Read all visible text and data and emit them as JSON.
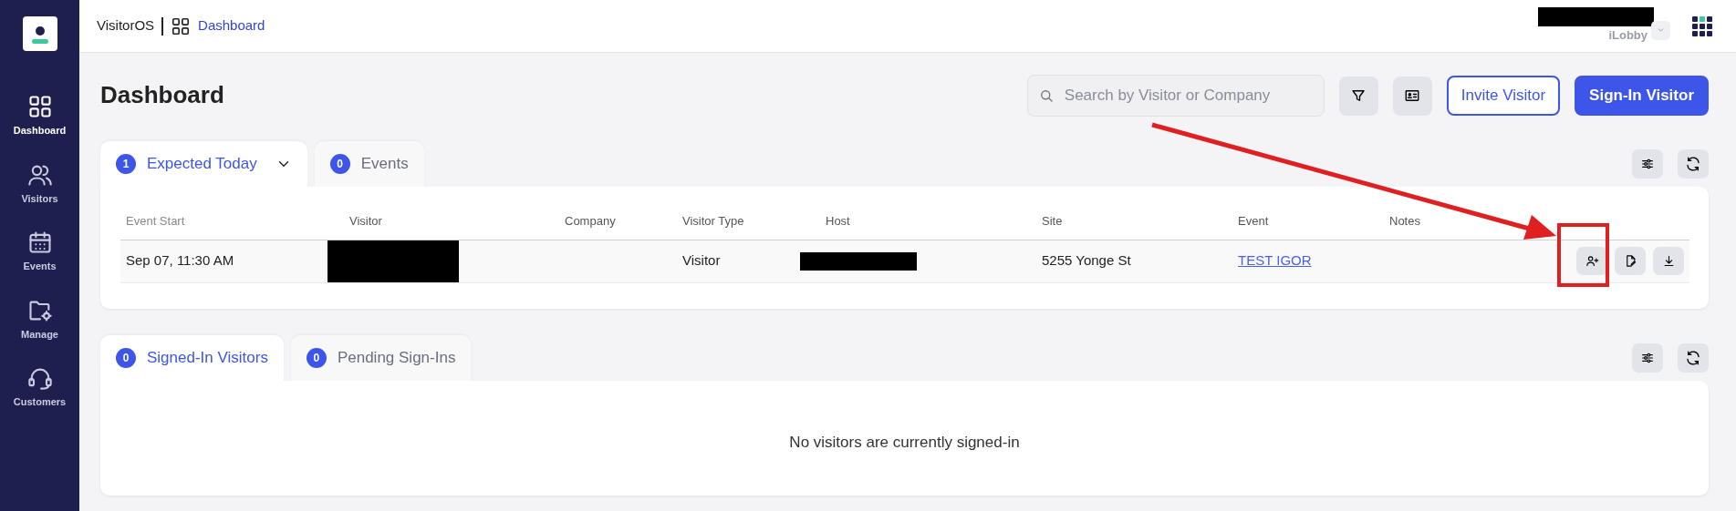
{
  "app": {
    "name": "VisitorOS",
    "breadcrumb": "Dashboard",
    "org": "iLobby",
    "user_redacted": true
  },
  "sidebar": {
    "items": [
      {
        "label": "Dashboard",
        "selected": true
      },
      {
        "label": "Visitors",
        "selected": false
      },
      {
        "label": "Events",
        "selected": false
      },
      {
        "label": "Manage",
        "selected": false
      },
      {
        "label": "Customers",
        "selected": false
      }
    ]
  },
  "page_title": "Dashboard",
  "search": {
    "placeholder": "Search by Visitor or Company"
  },
  "buttons": [
    {
      "label": "Invite Visitor",
      "kind": "outline"
    },
    {
      "label": "Sign-In Visitor",
      "kind": "primary"
    }
  ],
  "panels": [
    {
      "tabs": [
        {
          "count": "1",
          "label": "Expected Today",
          "selected": true,
          "dropdown": true
        },
        {
          "count": "0",
          "label": "Events",
          "selected": false,
          "dropdown": false
        }
      ],
      "table": {
        "columns": [
          "Event Start",
          "Visitor",
          "Company",
          "Visitor Type",
          "Host",
          "Site",
          "Event",
          "Notes"
        ],
        "rows": [
          {
            "cells": [
              {
                "kind": "text",
                "text": "Sep 07, 11:30 AM"
              },
              {
                "kind": "redacted"
              },
              {
                "kind": "empty"
              },
              {
                "kind": "text",
                "text": "Visitor"
              },
              {
                "kind": "redacted"
              },
              {
                "kind": "text",
                "text": "5255 Yonge St"
              },
              {
                "kind": "link",
                "text": "TEST IGOR"
              },
              {
                "kind": "empty"
              }
            ]
          }
        ]
      }
    },
    {
      "tabs": [
        {
          "count": "0",
          "label": "Signed-In Visitors",
          "selected": true,
          "dropdown": false
        },
        {
          "count": "0",
          "label": "Pending Sign-Ins",
          "selected": false,
          "dropdown": false
        }
      ],
      "empty_message": "No visitors are currently signed-in"
    }
  ],
  "annotations": {
    "arrow": true,
    "highlight_box": true
  }
}
